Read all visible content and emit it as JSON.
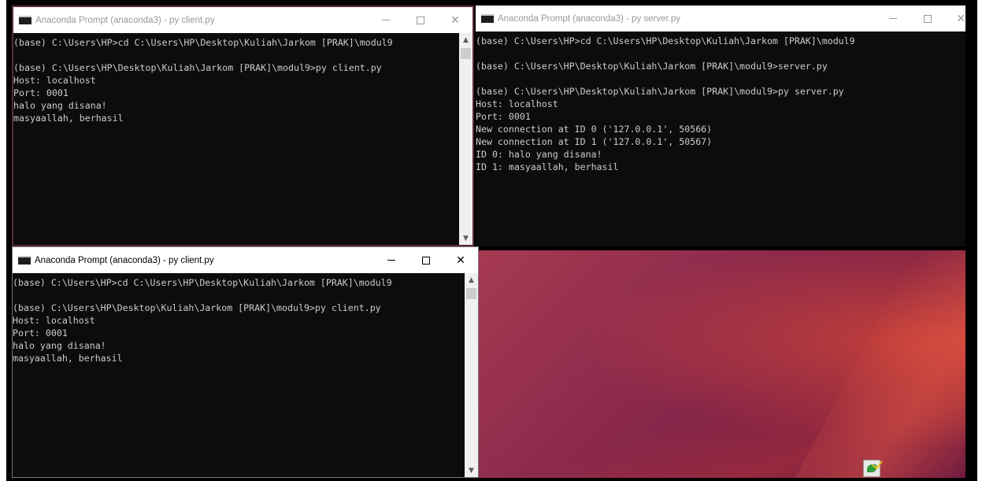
{
  "windows": {
    "client_top": {
      "title": "Anaconda Prompt (anaconda3) - py  client.py",
      "lines": [
        "(base) C:\\Users\\HP>cd C:\\Users\\HP\\Desktop\\Kuliah\\Jarkom [PRAK]\\modul9",
        "",
        "(base) C:\\Users\\HP\\Desktop\\Kuliah\\Jarkom [PRAK]\\modul9>py client.py",
        "Host: localhost",
        "Port: 0001",
        "halo yang disana!",
        "masyaallah, berhasil"
      ]
    },
    "server": {
      "title": "Anaconda Prompt (anaconda3) - py  server.py",
      "lines": [
        "(base) C:\\Users\\HP>cd C:\\Users\\HP\\Desktop\\Kuliah\\Jarkom [PRAK]\\modul9",
        "",
        "(base) C:\\Users\\HP\\Desktop\\Kuliah\\Jarkom [PRAK]\\modul9>server.py",
        "",
        "(base) C:\\Users\\HP\\Desktop\\Kuliah\\Jarkom [PRAK]\\modul9>py server.py",
        "Host: localhost",
        "Port: 0001",
        "New connection at ID 0 ('127.0.0.1', 50566)",
        "New connection at ID 1 ('127.0.0.1', 50567)",
        "ID 0: halo yang disana!",
        "ID 1: masyaallah, berhasil"
      ]
    },
    "client_bottom": {
      "title": "Anaconda Prompt (anaconda3) - py  client.py",
      "lines": [
        "(base) C:\\Users\\HP>cd C:\\Users\\HP\\Desktop\\Kuliah\\Jarkom [PRAK]\\modul9",
        "",
        "(base) C:\\Users\\HP\\Desktop\\Kuliah\\Jarkom [PRAK]\\modul9>py client.py",
        "Host: localhost",
        "Port: 0001",
        "halo yang disana!",
        "masyaallah, berhasil"
      ]
    }
  },
  "controls": {
    "minimize_icon": "minimize-icon",
    "maximize_icon": "maximize-icon",
    "close_icon": "close-icon",
    "close_glyph": "✕",
    "scroll_up_glyph": "▲",
    "scroll_down_glyph": "▼"
  },
  "colors": {
    "console_bg": "#0c0c0c",
    "console_text": "#cccccc",
    "desktop_accent": "#8c2a4c"
  }
}
